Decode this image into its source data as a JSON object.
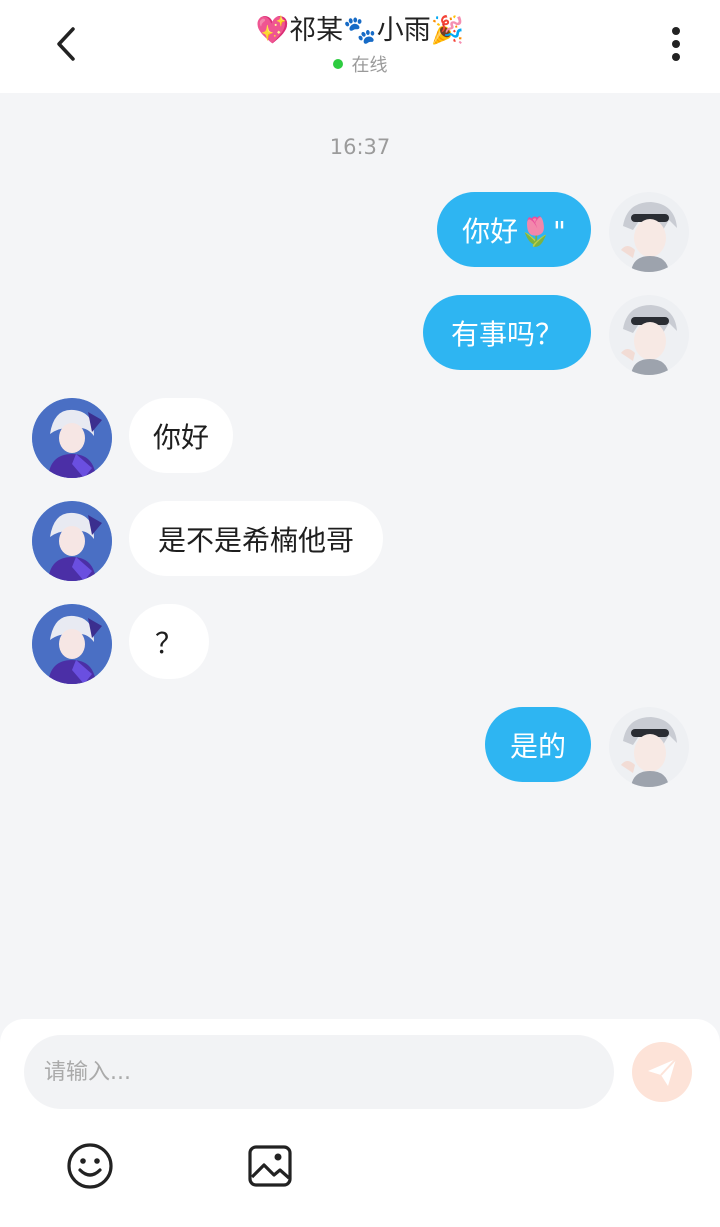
{
  "header": {
    "title": "💖祁某🐾小雨🎉",
    "status": "在线"
  },
  "chat": {
    "timestamp": "16:37",
    "messages": [
      {
        "side": "out",
        "text": "你好🌷\""
      },
      {
        "side": "out",
        "text": "有事吗？"
      },
      {
        "side": "in",
        "text": "你好"
      },
      {
        "side": "in",
        "text": "是不是希楠他哥"
      },
      {
        "side": "in",
        "text": "？"
      },
      {
        "side": "out",
        "text": "是的"
      }
    ]
  },
  "composer": {
    "placeholder": "请输入..."
  },
  "icons": {
    "back": "chevron-left-icon",
    "more": "more-vertical-icon",
    "send": "paper-plane-icon",
    "emoji": "emoji-smile-icon",
    "image": "image-icon"
  },
  "colors": {
    "outgoing_bubble": "#2eb5f2",
    "incoming_bubble": "#ffffff",
    "background": "#f4f5f7",
    "online_dot": "#2ecc40",
    "send_button": "#fde3d8"
  }
}
